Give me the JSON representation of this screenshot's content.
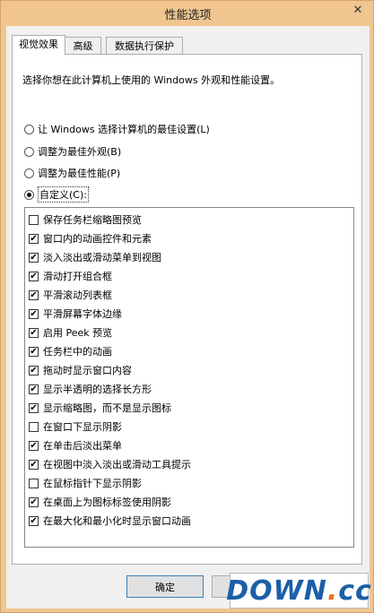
{
  "window": {
    "title": "性能选项",
    "close_glyph": "✕"
  },
  "tabs": [
    {
      "label": "视觉效果",
      "active": true
    },
    {
      "label": "高级",
      "active": false
    },
    {
      "label": "数据执行保护",
      "active": false
    }
  ],
  "panel": {
    "description": "选择你想在此计算机上使用的 Windows 外观和性能设置。",
    "radios": [
      {
        "label": "让 Windows 选择计算机的最佳设置(L)",
        "selected": false
      },
      {
        "label": "调整为最佳外观(B)",
        "selected": false
      },
      {
        "label": "调整为最佳性能(P)",
        "selected": false
      },
      {
        "label": "自定义(C):",
        "selected": true
      }
    ],
    "options": [
      {
        "label": "保存任务栏缩略图预览",
        "checked": false
      },
      {
        "label": "窗口内的动画控件和元素",
        "checked": true
      },
      {
        "label": "淡入淡出或滑动菜单到视图",
        "checked": true
      },
      {
        "label": "滑动打开组合框",
        "checked": true
      },
      {
        "label": "平滑滚动列表框",
        "checked": true
      },
      {
        "label": "平滑屏幕字体边缘",
        "checked": true
      },
      {
        "label": "启用 Peek 预览",
        "checked": true
      },
      {
        "label": "任务栏中的动画",
        "checked": true
      },
      {
        "label": "拖动时显示窗口内容",
        "checked": true
      },
      {
        "label": "显示半透明的选择长方形",
        "checked": true
      },
      {
        "label": "显示缩略图，而不是显示图标",
        "checked": true
      },
      {
        "label": "在窗口下显示阴影",
        "checked": false
      },
      {
        "label": "在单击后淡出菜单",
        "checked": true
      },
      {
        "label": "在视图中淡入淡出或滑动工具提示",
        "checked": true
      },
      {
        "label": "在鼠标指针下显示阴影",
        "checked": false
      },
      {
        "label": "在桌面上为图标标签使用阴影",
        "checked": true
      },
      {
        "label": "在最大化和最小化时显示窗口动画",
        "checked": true
      }
    ]
  },
  "buttons": {
    "ok_label": "确定"
  },
  "watermark": {
    "text_main": "DOWN",
    "text_dot": ".",
    "text_end": "cc"
  },
  "colors": {
    "frame": "#f0c58f",
    "default_button_border": "#3c7fb1",
    "watermark_blue": "#1a5fa8",
    "watermark_orange": "#e8731c"
  }
}
